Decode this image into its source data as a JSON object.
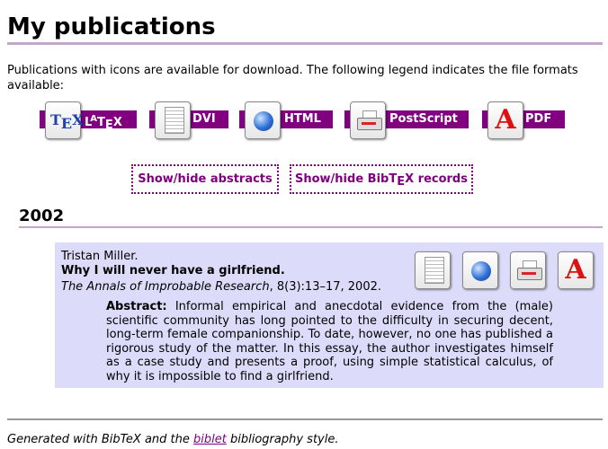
{
  "page": {
    "title": "My publications",
    "intro": "Publications with icons are available for download. The following legend indicates the file formats available:"
  },
  "legend": {
    "formats": [
      {
        "icon": "latex-icon",
        "label_before": "L",
        "label_sup": "A",
        "label_mid": "T",
        "label_sub": "E",
        "label_after": "X"
      },
      {
        "icon": "dvi-icon",
        "label": "DVI"
      },
      {
        "icon": "html-globe-icon",
        "label": "HTML"
      },
      {
        "icon": "postscript-printer-icon",
        "label": "PostScript"
      },
      {
        "icon": "pdf-icon",
        "label": "PDF"
      }
    ],
    "icon_text": {
      "tex_t": "T",
      "tex_e": "E",
      "tex_x": "X",
      "pdf": "A"
    }
  },
  "toggles": {
    "abstracts": "Show/hide abstracts",
    "bibtex_before": "Show/hide BibT",
    "bibtex_sub": "E",
    "bibtex_after": "X records"
  },
  "year": "2002",
  "publication": {
    "authors": "Tristan Miller.",
    "title": "Why I will never have a girlfriend.",
    "journal": "The Annals of Improbable Research",
    "details": ", 8(3):13–17, 2002.",
    "downloads": [
      "dvi-icon",
      "html-globe-icon",
      "postscript-printer-icon",
      "pdf-icon"
    ],
    "abstract_label": "Abstract:",
    "abstract": "Informal empirical and anecdotal evidence from the (male) scientific community has long pointed to the difficulty in securing decent, long-term female companionship. To date, however, no one has published a rigorous study of the matter. In this essay, the author investigates himself as a case study and presents a proof, using simple statistical calculus, of why it is impossible to find a girlfriend."
  },
  "footer": {
    "prefix": "Generated with BibTeX and the ",
    "link": "biblet",
    "suffix": " bibliography style."
  },
  "colors": {
    "accent": "#800080",
    "rule": "#c6a3cc",
    "entry_bg": "#dcdcfa"
  }
}
